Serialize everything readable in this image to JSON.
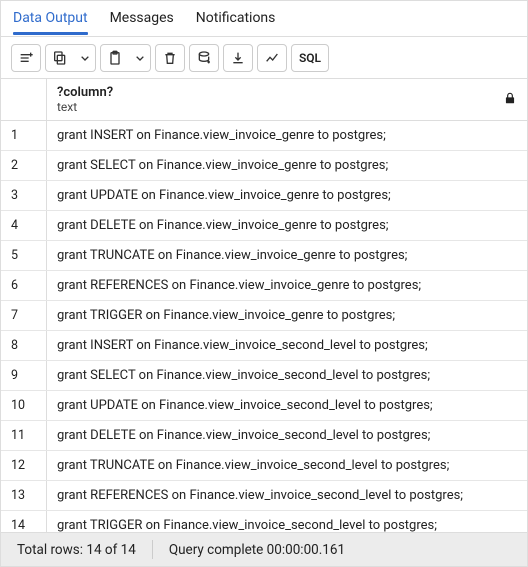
{
  "tabs": {
    "data_output": "Data Output",
    "messages": "Messages",
    "notifications": "Notifications"
  },
  "toolbar": {
    "sql_label": "SQL"
  },
  "grid": {
    "column": {
      "title": "?column?",
      "subtitle": "text"
    },
    "rows": [
      {
        "n": "1",
        "v": "grant INSERT on Finance.view_invoice_genre to postgres;"
      },
      {
        "n": "2",
        "v": "grant SELECT on Finance.view_invoice_genre to postgres;"
      },
      {
        "n": "3",
        "v": "grant UPDATE on Finance.view_invoice_genre to postgres;"
      },
      {
        "n": "4",
        "v": "grant DELETE on Finance.view_invoice_genre to postgres;"
      },
      {
        "n": "5",
        "v": "grant TRUNCATE on Finance.view_invoice_genre to postgres;"
      },
      {
        "n": "6",
        "v": "grant REFERENCES on Finance.view_invoice_genre to postgres;"
      },
      {
        "n": "7",
        "v": "grant TRIGGER on Finance.view_invoice_genre to postgres;"
      },
      {
        "n": "8",
        "v": "grant INSERT on Finance.view_invoice_second_level to postgres;"
      },
      {
        "n": "9",
        "v": "grant SELECT on Finance.view_invoice_second_level to postgres;"
      },
      {
        "n": "10",
        "v": "grant UPDATE on Finance.view_invoice_second_level to postgres;"
      },
      {
        "n": "11",
        "v": "grant DELETE on Finance.view_invoice_second_level to postgres;"
      },
      {
        "n": "12",
        "v": "grant TRUNCATE on Finance.view_invoice_second_level to postgres;"
      },
      {
        "n": "13",
        "v": "grant REFERENCES on Finance.view_invoice_second_level to postgres;"
      },
      {
        "n": "14",
        "v": "grant TRIGGER on Finance.view_invoice_second_level to postgres;"
      }
    ]
  },
  "status": {
    "total_rows": "Total rows: 14 of 14",
    "query_complete": "Query complete 00:00:00.161"
  }
}
